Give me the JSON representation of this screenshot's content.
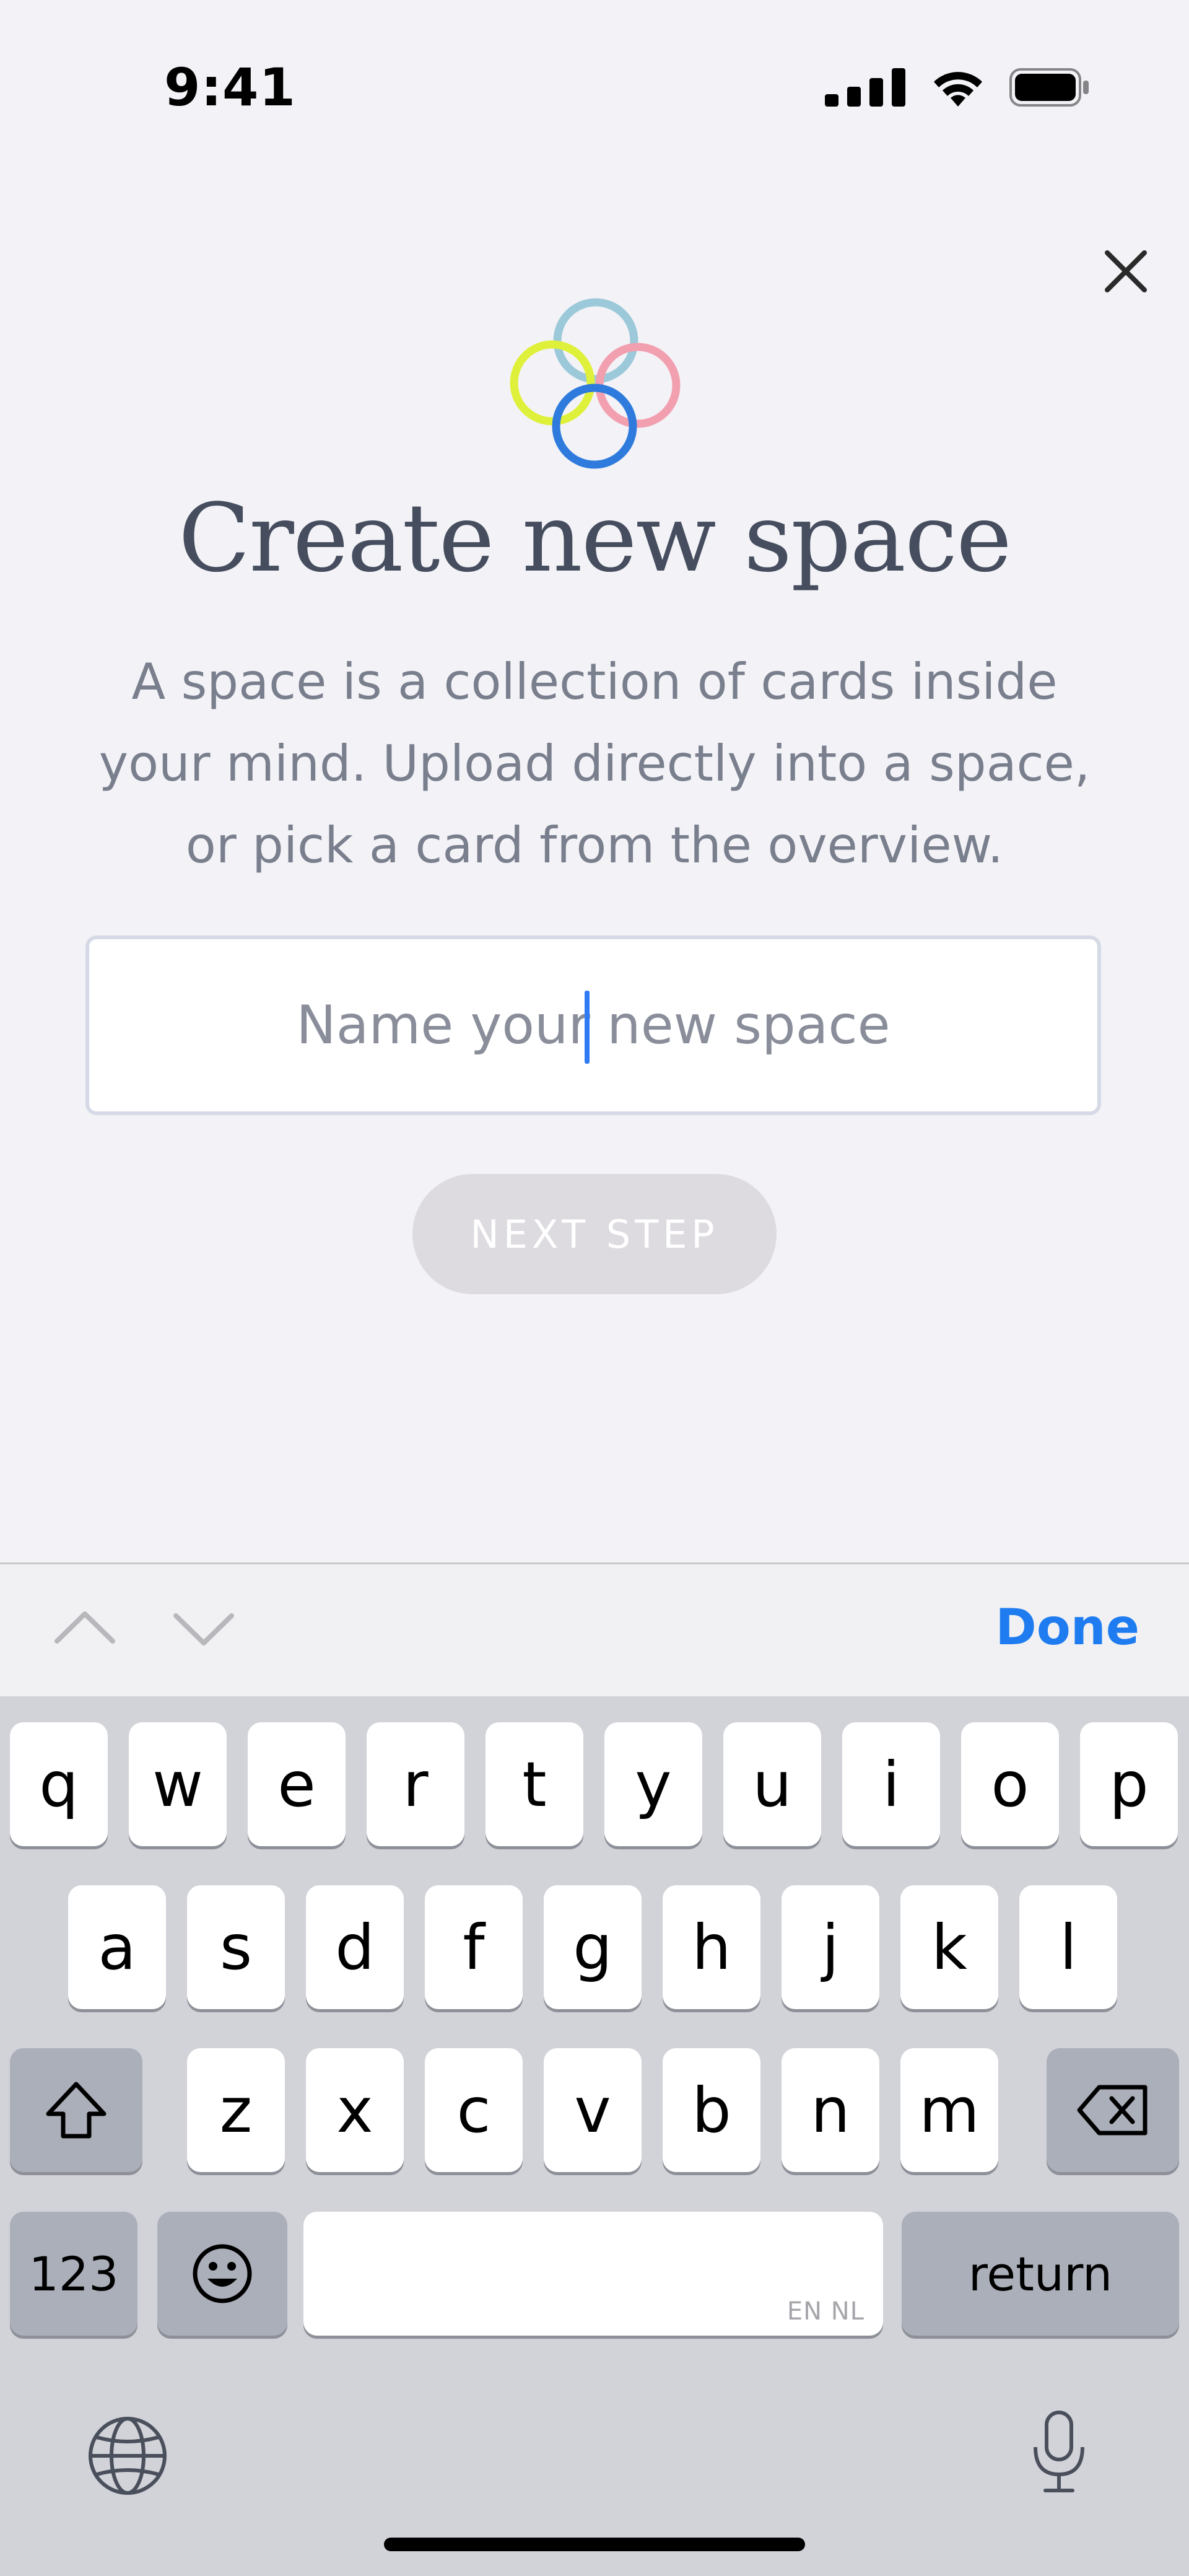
{
  "status_bar": {
    "time": "9:41"
  },
  "header": {
    "close_icon": "close-icon"
  },
  "main": {
    "title": "Create new space",
    "description_lines": [
      "A space is a collection of cards inside",
      "your mind. Upload directly into a space,",
      "or pick a card from the overview."
    ],
    "name_input": {
      "placeholder": "Name your new space",
      "value": ""
    },
    "next_button": "NEXT STEP"
  },
  "logo": {
    "ring_colors": [
      "#9cc9d9",
      "#dff03a",
      "#f2a0b0",
      "#2f7bdd"
    ]
  },
  "keyboard_toolbar": {
    "done_label": "Done",
    "up_icon": "chevron-up-icon",
    "down_icon": "chevron-down-icon"
  },
  "keyboard": {
    "row1": [
      "q",
      "w",
      "e",
      "r",
      "t",
      "y",
      "u",
      "i",
      "o",
      "p"
    ],
    "row2": [
      "a",
      "s",
      "d",
      "f",
      "g",
      "h",
      "j",
      "k",
      "l"
    ],
    "row3": [
      "z",
      "x",
      "c",
      "v",
      "b",
      "n",
      "m"
    ],
    "numbers_label": "123",
    "space_lang": "EN NL",
    "return_label": "return"
  },
  "colors": {
    "accent": "#1f7cf0",
    "title": "#464d5e",
    "caret": "#2f7bf5"
  }
}
